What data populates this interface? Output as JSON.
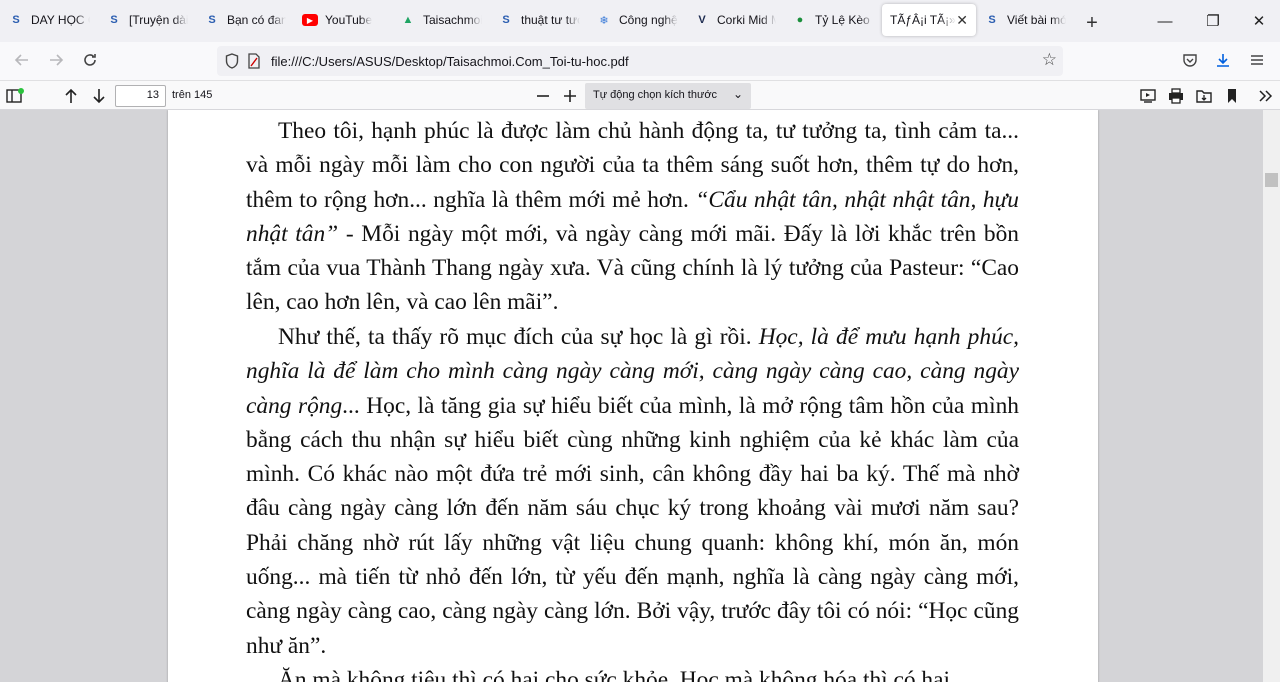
{
  "tabs": [
    {
      "label": "DAY HỌC C",
      "icon": "s-blue-icon",
      "color": "#2a5db0"
    },
    {
      "label": "[Truyện dài]",
      "icon": "s-blue-icon",
      "color": "#2a5db0"
    },
    {
      "label": "Bạn có đang",
      "icon": "s-blue-icon",
      "color": "#2a5db0"
    },
    {
      "label": "YouTube",
      "icon": "youtube-icon",
      "color": "#ff0000"
    },
    {
      "label": "Taisachmoi",
      "icon": "google-drive-icon",
      "color": "#1fa463"
    },
    {
      "label": "thuật tư tưở",
      "icon": "s-blue-icon",
      "color": "#2a5db0"
    },
    {
      "label": "Công nghệ",
      "icon": "snowflake-icon",
      "color": "#3b7bd8"
    },
    {
      "label": "Corki Mid M",
      "icon": "v-logo-icon",
      "color": "#1c2a4f"
    },
    {
      "label": "Tỷ Lệ Kèo N",
      "icon": "green-circle-icon",
      "color": "#1b8f3c"
    },
    {
      "label": "TÃƒÂ¡i TÃ¡»•",
      "icon": "",
      "color": "#ffffff",
      "active": true
    },
    {
      "label": "Viết bài mớ",
      "icon": "s-blue-icon",
      "color": "#2a5db0"
    }
  ],
  "window": {
    "new_tab": "+",
    "minimize": "—",
    "maximize": "❐",
    "close": "✕",
    "tab_close": "✕"
  },
  "nav": {
    "url": "file:///C:/Users/ASUS/Desktop/Taisachmoi.Com_Toi-tu-hoc.pdf"
  },
  "pdf_toolbar": {
    "page_number": "13",
    "page_total": "trên 145",
    "zoom_label": "Tự động chọn kích thước"
  },
  "document": {
    "p1_text1": "Theo tôi, hạnh phúc là được làm chủ hành động ta, tư tưởng ta, tình cảm ta... và mỗi ngày mỗi làm cho con người của ta thêm sáng suốt hơn, thêm tự do hơn, thêm to rộng hơn... nghĩa là thêm mới mẻ hơn. ",
    "p1_italic": "“Cẩu nhật tân, nhật nhật tân, hựu nhật tân”",
    "p1_text2": " - Mỗi ngày một mới, và ngày càng mới mãi. Đấy là lời khắc trên bồn tắm của vua Thành Thang ngày xưa. Và cũng chính là lý tưởng của Pasteur: “Cao lên, cao hơn lên, và cao lên mãi”.",
    "p2_text1": "Như thế, ta thấy rõ mục đích của sự học là gì rồi. ",
    "p2_italic": "Học, là để mưu hạnh phúc, nghĩa là để làm cho mình càng ngày càng mới, càng ngày càng cao, càng ngày càng rộng",
    "p2_text2": "... Học, là tăng gia sự hiểu biết của mình, là mở rộng tâm hồn của mình bằng cách thu nhận sự hiểu biết cùng những kinh nghiệm của kẻ khác làm của mình. Có khác nào một đứa trẻ mới sinh, cân không đầy hai ba ký. Thế mà nhờ đâu càng ngày càng lớn đến năm sáu chục ký trong khoảng vài mươi năm sau? Phải chăng nhờ rút lấy những vật liệu chung quanh: không khí, món ăn, món uống... mà tiến từ nhỏ đến lớn, từ yếu đến mạnh, nghĩa là càng ngày càng mới, càng ngày càng cao, càng ngày càng lớn. Bởi vậy, trước đây tôi có nói: “Học cũng như ăn”.",
    "p3_text": "Ăn mà không tiêu thì có hại cho sức khỏe. Học mà không hóa thì có hại"
  }
}
